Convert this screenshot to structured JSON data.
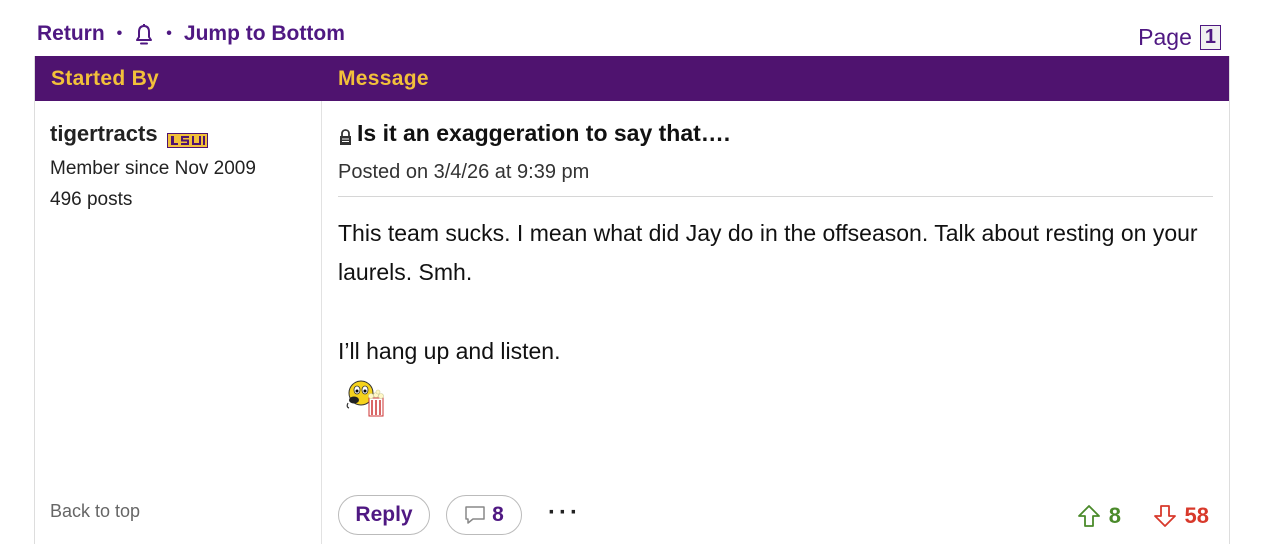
{
  "topnav": {
    "return_label": "Return",
    "separator": "•",
    "bell_icon": "bell-icon",
    "jump_label": "Jump to Bottom"
  },
  "pager": {
    "label": "Page",
    "current": "1"
  },
  "table_header": {
    "col_author": "Started By",
    "col_message": "Message"
  },
  "author": {
    "username": "tigertracts",
    "badge_icon": "lsu-badge-icon",
    "member_since": "Member since Nov 2009",
    "posts": "496 posts",
    "back_to_top": "Back to top"
  },
  "post": {
    "lock_icon": "lock-icon",
    "title": "Is it an exaggeration to say that….",
    "posted_on": "Posted on 3/4/26 at 9:39 pm",
    "body_line1": "This team sucks. I mean what did Jay do in the offseason. Talk about resting on your laurels. Smh.",
    "body_line2": "I’ll hang up and listen.",
    "emoticon": "popcorn-emoticon"
  },
  "actions": {
    "reply_label": "Reply",
    "comment_count": "8",
    "more_label": "···",
    "upvotes": "8",
    "downvotes": "58"
  },
  "colors": {
    "brand_purple": "#4f136f",
    "brand_gold": "#f2c03a",
    "link_purple": "#4f1882",
    "upvote_green": "#4a8a2a",
    "downvote_red": "#d8392b"
  }
}
